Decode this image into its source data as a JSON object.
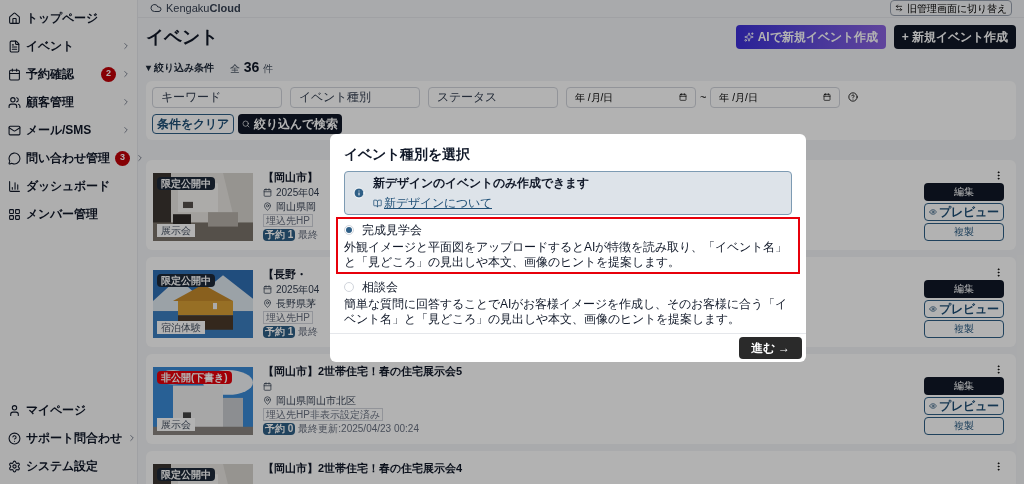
{
  "sidebar": {
    "items": [
      {
        "label": "トップページ",
        "has_submenu": false
      },
      {
        "label": "イベント",
        "has_submenu": true
      },
      {
        "label": "予約確認",
        "has_submenu": true,
        "badge": "2"
      },
      {
        "label": "顧客管理",
        "has_submenu": true
      },
      {
        "label": "メール/SMS",
        "has_submenu": true
      },
      {
        "label": "問い合わせ管理",
        "has_submenu": true,
        "badge": "3"
      },
      {
        "label": "ダッシュボード",
        "has_submenu": false
      },
      {
        "label": "メンバー管理",
        "has_submenu": false
      }
    ],
    "bottom_items": [
      {
        "label": "マイページ",
        "has_submenu": false
      },
      {
        "label": "サポート問合わせ",
        "has_submenu": true
      },
      {
        "label": "システム設定",
        "has_submenu": false
      }
    ]
  },
  "header": {
    "logo": "Kengaku**Cloud**",
    "switch_button": "旧管理画面に切り替え"
  },
  "page": {
    "title": "イベント",
    "ai_button": "AIで新規イベント作成",
    "new_button": "+ 新規イベント作成",
    "filter_toggle": "▾ 絞り込み条件",
    "total_prefix": "全",
    "total": "36",
    "total_suffix": "件"
  },
  "filters": {
    "fields": [
      {
        "placeholder": "キーワード"
      },
      {
        "placeholder": "イベント種別"
      },
      {
        "placeholder": "ステータス"
      }
    ],
    "date_from": "年 /月/日",
    "range_sep": "~",
    "date_to": "年 /月/日",
    "clear_button": "条件をクリア",
    "search_button": "絞り込んで検索"
  },
  "events": [
    {
      "status": "限定公開中",
      "published": true,
      "category": "展示会",
      "title": "【岡山市】",
      "date": "2025年04",
      "location": "岡山県岡",
      "tag": "埋込先HP",
      "reservations": "予約 1",
      "updated": "最終",
      "actions": [
        "編集",
        "プレビュー",
        "複製"
      ]
    },
    {
      "status": "限定公開中",
      "published": true,
      "category": "宿泊体験",
      "title": "【長野・",
      "date": "2025年04",
      "location": "長野県茅",
      "tag": "埋込先HP",
      "reservations": "予約 1",
      "updated": "最終",
      "actions": [
        "編集",
        "プレビュー",
        "複製"
      ]
    },
    {
      "status": "非公開(下書き)",
      "published": false,
      "category": "展示会",
      "title": "【岡山市】2世帯住宅！春の住宅展示会5",
      "location": "岡山県岡山市北区",
      "tag": "埋込先HP非表示設定済み",
      "reservations": "予約 0",
      "updated": "最終更新:2025/04/23 00:24",
      "actions": [
        "編集",
        "プレビュー",
        "複製"
      ]
    },
    {
      "status": "限定公開中",
      "published": true,
      "title": "【岡山市】2世帯住宅！春の住宅展示会4"
    }
  ],
  "modal": {
    "title": "イベント種別を選択",
    "notice": "新デザインのイベントのみ作成できます",
    "notice_link": "新デザインについて",
    "options": [
      {
        "label": "完成見学会",
        "selected": true,
        "highlighted": true,
        "description": "外観イメージと平面図をアップロードするとAIが特徴を読み取り、「イベント名」と「見どころ」の見出しや本文、画像のヒントを提案します。"
      },
      {
        "label": "相談会",
        "selected": false,
        "highlighted": false,
        "description": "簡単な質問に回答することでAIがお客様イメージを作成し、そのお客様に合う「イベント名」と「見どころ」の見出しや本文、画像のヒントを提案します。"
      }
    ],
    "next_button": "進む →"
  }
}
